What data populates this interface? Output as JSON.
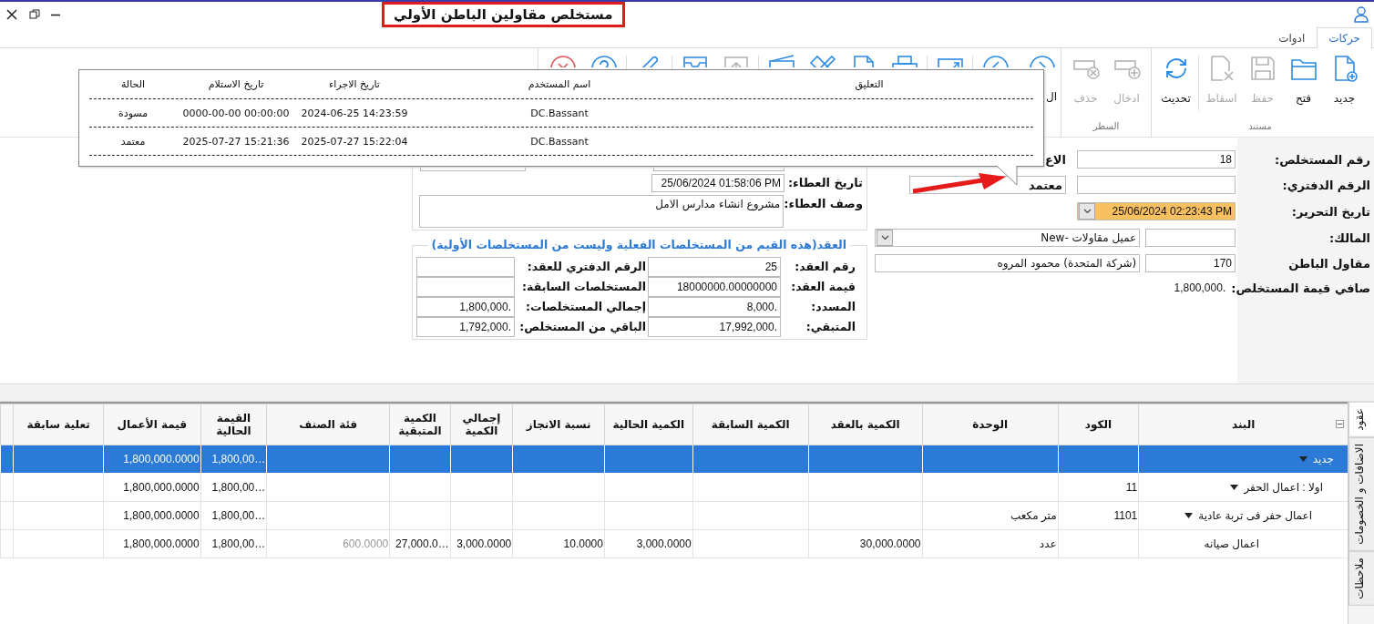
{
  "window": {
    "title": "مستخلص مقاولين الباطن الأولي"
  },
  "tabs": [
    {
      "label": "حركات",
      "selected": true
    },
    {
      "label": "ادوات",
      "selected": false
    }
  ],
  "ribbon": {
    "groups": [
      {
        "caption": "مستند",
        "buttons": [
          {
            "kind": "new",
            "label": "جديد",
            "disabled": false
          },
          {
            "kind": "open",
            "label": "فتح",
            "disabled": false
          },
          {
            "kind": "save",
            "label": "حفظ",
            "disabled": true
          },
          {
            "kind": "cancel-doc",
            "label": "اسقاط",
            "disabled": true
          },
          {
            "kind": "refresh",
            "label": "تحديث",
            "disabled": false,
            "separated": true
          }
        ]
      },
      {
        "caption": "السطر",
        "buttons": [
          {
            "kind": "insert-row",
            "label": "ادخال",
            "disabled": true
          },
          {
            "kind": "delete-row",
            "label": "حذف",
            "disabled": true
          }
        ]
      },
      {
        "buttons": [
          {
            "kind": "next",
            "label": "ال",
            "disabled": false
          },
          {
            "kind": "prev",
            "disabled": false
          },
          {
            "kind": "expand",
            "disabled": false,
            "separated": true
          },
          {
            "kind": "printer",
            "disabled": false,
            "separated": true
          },
          {
            "kind": "document",
            "disabled": false
          },
          {
            "kind": "tools",
            "disabled": false
          },
          {
            "kind": "scanner",
            "disabled": false
          },
          {
            "kind": "upload",
            "disabled": true,
            "separated": true
          },
          {
            "kind": "tray",
            "disabled": false
          },
          {
            "kind": "paperclip",
            "disabled": false,
            "separated": true
          },
          {
            "kind": "help",
            "disabled": false,
            "separated": true
          },
          {
            "kind": "close",
            "disabled": false
          }
        ]
      }
    ]
  },
  "approval_log": {
    "columns": [
      "التعليق",
      "اسم المستخدم",
      "تاريخ الاجراء",
      "تاريخ الاستلام",
      "الحالة"
    ],
    "rows": [
      {
        "user": "DC.Bassant",
        "action_date": "2024-06-25 14:23:59",
        "received_date": "0000-00-00 00:00:00",
        "status": "مسودة"
      },
      {
        "user": "DC.Bassant",
        "action_date": "2025-07-27 15:22:04",
        "received_date": "2025-07-27 15:21:36",
        "status": "معتمد"
      }
    ]
  },
  "form": {
    "fields": [
      {
        "kind": "text",
        "label": "رقم المستخلص:",
        "value": "18",
        "side_label": "الاع"
      },
      {
        "kind": "text",
        "label": "الرقم الدفتري:",
        "side_value": "معتمد"
      },
      {
        "kind": "date",
        "label": "تاريخ التحرير:",
        "value": "25/06/2024 02:23:43 PM",
        "highlighted": true
      },
      {
        "kind": "lookup-combo",
        "label": "المالك:",
        "name": "عميل مقاولات -New"
      },
      {
        "kind": "lookup",
        "label": "مقاول الباطن",
        "code": "170",
        "name": "(شركة المتحدة) محمود المروه"
      },
      {
        "kind": "readout",
        "label": "صافي قيمة المستخلص:",
        "value": "1,800,000."
      }
    ]
  },
  "tender": {
    "fields": [
      {
        "kind": "field-pair"
      },
      {
        "kind": "text",
        "label": "تاريخ العطاء:",
        "value": "25/06/2024 01:58:06 PM"
      },
      {
        "kind": "memo",
        "label": "وصف العطاء:",
        "value": "مشروع انشاء مدارس الامل"
      }
    ]
  },
  "contract": {
    "legend": "العقد(هذه القيم من المستخلصات الفعلية وليست من المستخلصات الأولية)",
    "rows": [
      [
        {
          "label": "رقم العقد:",
          "value": "25"
        },
        {
          "label": "الرقم الدفتري للعقد:"
        }
      ],
      [
        {
          "label": "قيمة العقد:",
          "value": "18000000.00000000"
        },
        {
          "label": "المستخلصات السابقة:"
        }
      ],
      [
        {
          "label": "المسدد:",
          "value": "8,000."
        },
        {
          "label": "إجمالي المستخلصات:",
          "value": "1,800,000."
        }
      ],
      [
        {
          "label": "المتبقي:",
          "value": "17,992,000."
        },
        {
          "label": "الباقي من المستخلص:",
          "value": "1,792,000."
        }
      ]
    ]
  },
  "grid": {
    "columns": [
      "البند",
      "الكود",
      "الوحدة",
      "الكمية بالعقد",
      "الكمية السابقة",
      "الكمية الحالية",
      "نسبة الانجاز",
      "إجمالي الكمية",
      "الكمية المتبقية",
      "فئة الصنف",
      "القيمة الحالية",
      "قيمة الأعمال",
      "تعلية سابقة"
    ],
    "rows": [
      {
        "item": "جديد",
        "current_value": "1,800,00…",
        "work_value": "1,800,000.0000",
        "selected": true,
        "expanded": true,
        "children": [
          {
            "item": "اولا : اعمال الحفر",
            "code": "11",
            "current_value": "1,800,00…",
            "work_value": "1,800,000.0000",
            "selected": false,
            "expanded": true,
            "children": [
              {
                "item": "اعمال حفر فى تربة عادية",
                "code": "1101",
                "unit": "متر مكعب",
                "current_value": "1,800,00…",
                "work_value": "1,800,000.0000",
                "selected": false,
                "expanded": true,
                "children": [
                  {
                    "item": "اعمال صيانه",
                    "unit": "عدد",
                    "contract_qty": "30,000.0000",
                    "current_qty": "3,000.0000",
                    "progress": "10.0000",
                    "total_qty": "3,000.0000",
                    "remaining_qty": "27,000.0…",
                    "category": "600.0000",
                    "current_value": "1,800,00…",
                    "work_value": "1,800,000.0000",
                    "selected": false,
                    "category_greyed": true
                  }
                ]
              }
            ]
          }
        ]
      }
    ]
  },
  "side_tabs": [
    {
      "label": "عقود",
      "selected": true
    },
    {
      "label": "الاضافات و الخصومات",
      "selected": false
    },
    {
      "label": "ملاحظات",
      "selected": false
    }
  ]
}
